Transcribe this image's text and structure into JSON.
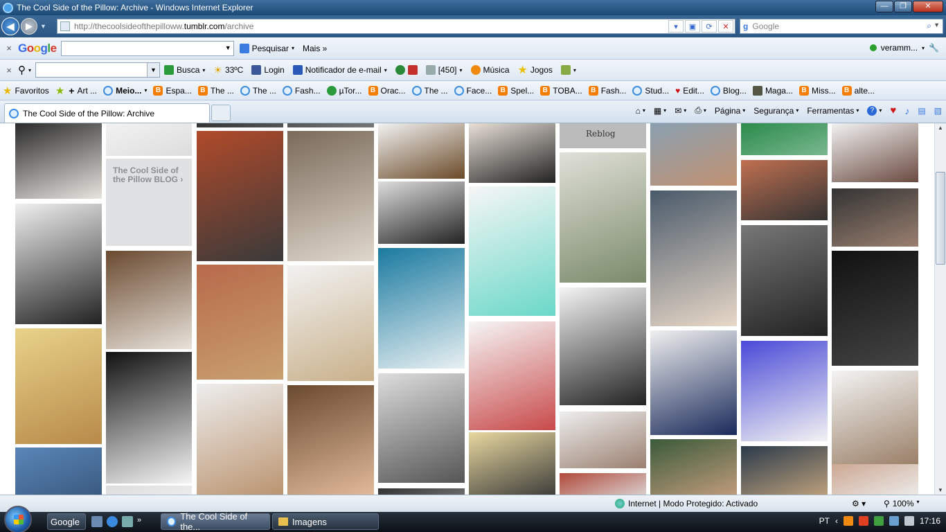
{
  "window": {
    "title": "The Cool Side of the Pillow: Archive - Windows Internet Explorer",
    "minimize": "—",
    "maximize": "❐",
    "close": "✕"
  },
  "nav": {
    "url_prefix": "http://thecoolsideofthepilloww.",
    "url_domain": "tumblr.com",
    "url_path": "/archive",
    "search_placeholder": "Google"
  },
  "google_toolbar": {
    "close": "×",
    "logo": [
      "G",
      "o",
      "o",
      "g",
      "l",
      "e"
    ],
    "search_button": "Pesquisar",
    "more": "Mais »",
    "account": "veramm..."
  },
  "toolbar2": {
    "close": "×",
    "busca": "Busca",
    "weather": "33ºC",
    "login": "Login",
    "email": "Notificador de e-mail",
    "count": "[450]",
    "music": "Música",
    "games": "Jogos"
  },
  "favorites": {
    "label": "Favoritos",
    "items": [
      {
        "label": "Art ...",
        "type": "plus"
      },
      {
        "label": "Meio...",
        "type": "ie"
      },
      {
        "label": "Espa...",
        "type": "blogger"
      },
      {
        "label": "The ...",
        "type": "blogger"
      },
      {
        "label": "The ...",
        "type": "ie"
      },
      {
        "label": "Fash...",
        "type": "ie"
      },
      {
        "label": "µTor...",
        "type": "utorrent"
      },
      {
        "label": "Orac...",
        "type": "blogger"
      },
      {
        "label": "The ...",
        "type": "ie"
      },
      {
        "label": "Face...",
        "type": "ie"
      },
      {
        "label": "Spel...",
        "type": "blogger"
      },
      {
        "label": "TOBA...",
        "type": "blogger"
      },
      {
        "label": "Fash...",
        "type": "blogger"
      },
      {
        "label": "Stud...",
        "type": "ie"
      },
      {
        "label": "Edit...",
        "type": "lips"
      },
      {
        "label": "Blog...",
        "type": "ie"
      },
      {
        "label": "Maga...",
        "type": "bag"
      },
      {
        "label": "Miss...",
        "type": "blogger"
      },
      {
        "label": "alte...",
        "type": "blogger"
      }
    ]
  },
  "tab": {
    "title": "The Cool Side of the Pillow: Archive"
  },
  "command_bar": {
    "page": "Página",
    "safety": "Segurança",
    "tools": "Ferramentas",
    "help": "?"
  },
  "content": {
    "blog_tile": "The Cool Side of the Pillow BLOG",
    "blog_tile_arrow": "›",
    "reblog": "Reblog",
    "colors": {
      "page_bg": "#ffffff",
      "tile_bg": "#dfe1e3"
    }
  },
  "statusbar": {
    "zone": "Internet | Modo Protegido: Activado",
    "zoom": "100%"
  },
  "taskbar": {
    "apps": [
      {
        "label": "Google"
      },
      {
        "label": "The Cool Side of the..."
      },
      {
        "label": "Imagens"
      }
    ],
    "lang": "PT",
    "time": "17:16"
  }
}
